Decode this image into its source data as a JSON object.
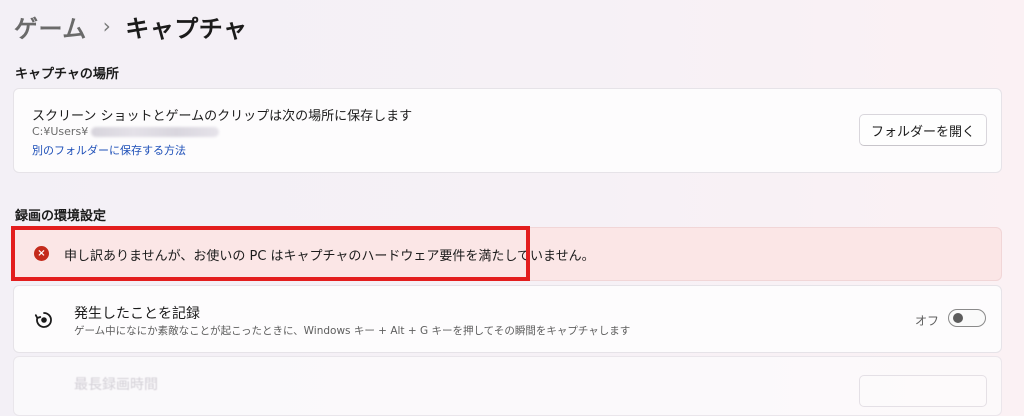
{
  "breadcrumb": {
    "parent": "ゲーム",
    "separator": "›",
    "current": "キャプチャ"
  },
  "capture_location": {
    "section_title": "キャプチャの場所",
    "description": "スクリーン ショットとゲームのクリップは次の場所に保存します",
    "path_prefix": "C:¥Users¥",
    "help_link": "別のフォルダーに保存する方法",
    "open_button": "フォルダーを開く"
  },
  "recording": {
    "section_title": "録画の環境設定",
    "error": {
      "icon": "error-circle-icon",
      "icon_glyph": "×",
      "message": "申し訳ありませんが、お使いの PC はキャプチャのハードウェア要件を満たしていません。",
      "color": "#c42b1c",
      "highlight_color": "#e31e1e"
    },
    "record_what_happened": {
      "icon": "record-icon",
      "title": "発生したことを記録",
      "description": "ゲーム中になにか素敵なことが起こったときに、Windows キー + Alt + G キーを押してその瞬間をキャプチャします",
      "toggle_state_label": "オフ",
      "toggle_on": false
    },
    "next_item": {
      "title": "最長録画時間"
    }
  },
  "colors": {
    "link": "#1d4fb8",
    "error_background": "#fbe6e6"
  }
}
